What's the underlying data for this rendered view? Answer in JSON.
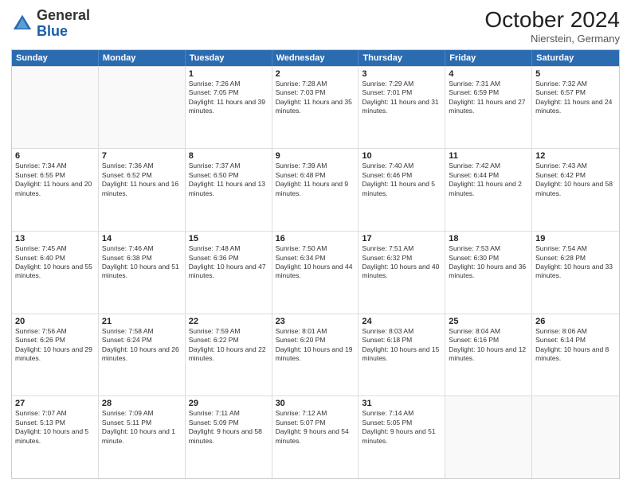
{
  "header": {
    "logo": {
      "general": "General",
      "blue": "Blue"
    },
    "title": "October 2024",
    "subtitle": "Nierstein, Germany"
  },
  "weekdays": [
    "Sunday",
    "Monday",
    "Tuesday",
    "Wednesday",
    "Thursday",
    "Friday",
    "Saturday"
  ],
  "rows": [
    [
      {
        "day": "",
        "sunrise": "",
        "sunset": "",
        "daylight": ""
      },
      {
        "day": "",
        "sunrise": "",
        "sunset": "",
        "daylight": ""
      },
      {
        "day": "1",
        "sunrise": "Sunrise: 7:26 AM",
        "sunset": "Sunset: 7:05 PM",
        "daylight": "Daylight: 11 hours and 39 minutes."
      },
      {
        "day": "2",
        "sunrise": "Sunrise: 7:28 AM",
        "sunset": "Sunset: 7:03 PM",
        "daylight": "Daylight: 11 hours and 35 minutes."
      },
      {
        "day": "3",
        "sunrise": "Sunrise: 7:29 AM",
        "sunset": "Sunset: 7:01 PM",
        "daylight": "Daylight: 11 hours and 31 minutes."
      },
      {
        "day": "4",
        "sunrise": "Sunrise: 7:31 AM",
        "sunset": "Sunset: 6:59 PM",
        "daylight": "Daylight: 11 hours and 27 minutes."
      },
      {
        "day": "5",
        "sunrise": "Sunrise: 7:32 AM",
        "sunset": "Sunset: 6:57 PM",
        "daylight": "Daylight: 11 hours and 24 minutes."
      }
    ],
    [
      {
        "day": "6",
        "sunrise": "Sunrise: 7:34 AM",
        "sunset": "Sunset: 6:55 PM",
        "daylight": "Daylight: 11 hours and 20 minutes."
      },
      {
        "day": "7",
        "sunrise": "Sunrise: 7:36 AM",
        "sunset": "Sunset: 6:52 PM",
        "daylight": "Daylight: 11 hours and 16 minutes."
      },
      {
        "day": "8",
        "sunrise": "Sunrise: 7:37 AM",
        "sunset": "Sunset: 6:50 PM",
        "daylight": "Daylight: 11 hours and 13 minutes."
      },
      {
        "day": "9",
        "sunrise": "Sunrise: 7:39 AM",
        "sunset": "Sunset: 6:48 PM",
        "daylight": "Daylight: 11 hours and 9 minutes."
      },
      {
        "day": "10",
        "sunrise": "Sunrise: 7:40 AM",
        "sunset": "Sunset: 6:46 PM",
        "daylight": "Daylight: 11 hours and 5 minutes."
      },
      {
        "day": "11",
        "sunrise": "Sunrise: 7:42 AM",
        "sunset": "Sunset: 6:44 PM",
        "daylight": "Daylight: 11 hours and 2 minutes."
      },
      {
        "day": "12",
        "sunrise": "Sunrise: 7:43 AM",
        "sunset": "Sunset: 6:42 PM",
        "daylight": "Daylight: 10 hours and 58 minutes."
      }
    ],
    [
      {
        "day": "13",
        "sunrise": "Sunrise: 7:45 AM",
        "sunset": "Sunset: 6:40 PM",
        "daylight": "Daylight: 10 hours and 55 minutes."
      },
      {
        "day": "14",
        "sunrise": "Sunrise: 7:46 AM",
        "sunset": "Sunset: 6:38 PM",
        "daylight": "Daylight: 10 hours and 51 minutes."
      },
      {
        "day": "15",
        "sunrise": "Sunrise: 7:48 AM",
        "sunset": "Sunset: 6:36 PM",
        "daylight": "Daylight: 10 hours and 47 minutes."
      },
      {
        "day": "16",
        "sunrise": "Sunrise: 7:50 AM",
        "sunset": "Sunset: 6:34 PM",
        "daylight": "Daylight: 10 hours and 44 minutes."
      },
      {
        "day": "17",
        "sunrise": "Sunrise: 7:51 AM",
        "sunset": "Sunset: 6:32 PM",
        "daylight": "Daylight: 10 hours and 40 minutes."
      },
      {
        "day": "18",
        "sunrise": "Sunrise: 7:53 AM",
        "sunset": "Sunset: 6:30 PM",
        "daylight": "Daylight: 10 hours and 36 minutes."
      },
      {
        "day": "19",
        "sunrise": "Sunrise: 7:54 AM",
        "sunset": "Sunset: 6:28 PM",
        "daylight": "Daylight: 10 hours and 33 minutes."
      }
    ],
    [
      {
        "day": "20",
        "sunrise": "Sunrise: 7:56 AM",
        "sunset": "Sunset: 6:26 PM",
        "daylight": "Daylight: 10 hours and 29 minutes."
      },
      {
        "day": "21",
        "sunrise": "Sunrise: 7:58 AM",
        "sunset": "Sunset: 6:24 PM",
        "daylight": "Daylight: 10 hours and 26 minutes."
      },
      {
        "day": "22",
        "sunrise": "Sunrise: 7:59 AM",
        "sunset": "Sunset: 6:22 PM",
        "daylight": "Daylight: 10 hours and 22 minutes."
      },
      {
        "day": "23",
        "sunrise": "Sunrise: 8:01 AM",
        "sunset": "Sunset: 6:20 PM",
        "daylight": "Daylight: 10 hours and 19 minutes."
      },
      {
        "day": "24",
        "sunrise": "Sunrise: 8:03 AM",
        "sunset": "Sunset: 6:18 PM",
        "daylight": "Daylight: 10 hours and 15 minutes."
      },
      {
        "day": "25",
        "sunrise": "Sunrise: 8:04 AM",
        "sunset": "Sunset: 6:16 PM",
        "daylight": "Daylight: 10 hours and 12 minutes."
      },
      {
        "day": "26",
        "sunrise": "Sunrise: 8:06 AM",
        "sunset": "Sunset: 6:14 PM",
        "daylight": "Daylight: 10 hours and 8 minutes."
      }
    ],
    [
      {
        "day": "27",
        "sunrise": "Sunrise: 7:07 AM",
        "sunset": "Sunset: 5:13 PM",
        "daylight": "Daylight: 10 hours and 5 minutes."
      },
      {
        "day": "28",
        "sunrise": "Sunrise: 7:09 AM",
        "sunset": "Sunset: 5:11 PM",
        "daylight": "Daylight: 10 hours and 1 minute."
      },
      {
        "day": "29",
        "sunrise": "Sunrise: 7:11 AM",
        "sunset": "Sunset: 5:09 PM",
        "daylight": "Daylight: 9 hours and 58 minutes."
      },
      {
        "day": "30",
        "sunrise": "Sunrise: 7:12 AM",
        "sunset": "Sunset: 5:07 PM",
        "daylight": "Daylight: 9 hours and 54 minutes."
      },
      {
        "day": "31",
        "sunrise": "Sunrise: 7:14 AM",
        "sunset": "Sunset: 5:05 PM",
        "daylight": "Daylight: 9 hours and 51 minutes."
      },
      {
        "day": "",
        "sunrise": "",
        "sunset": "",
        "daylight": ""
      },
      {
        "day": "",
        "sunrise": "",
        "sunset": "",
        "daylight": ""
      }
    ]
  ]
}
